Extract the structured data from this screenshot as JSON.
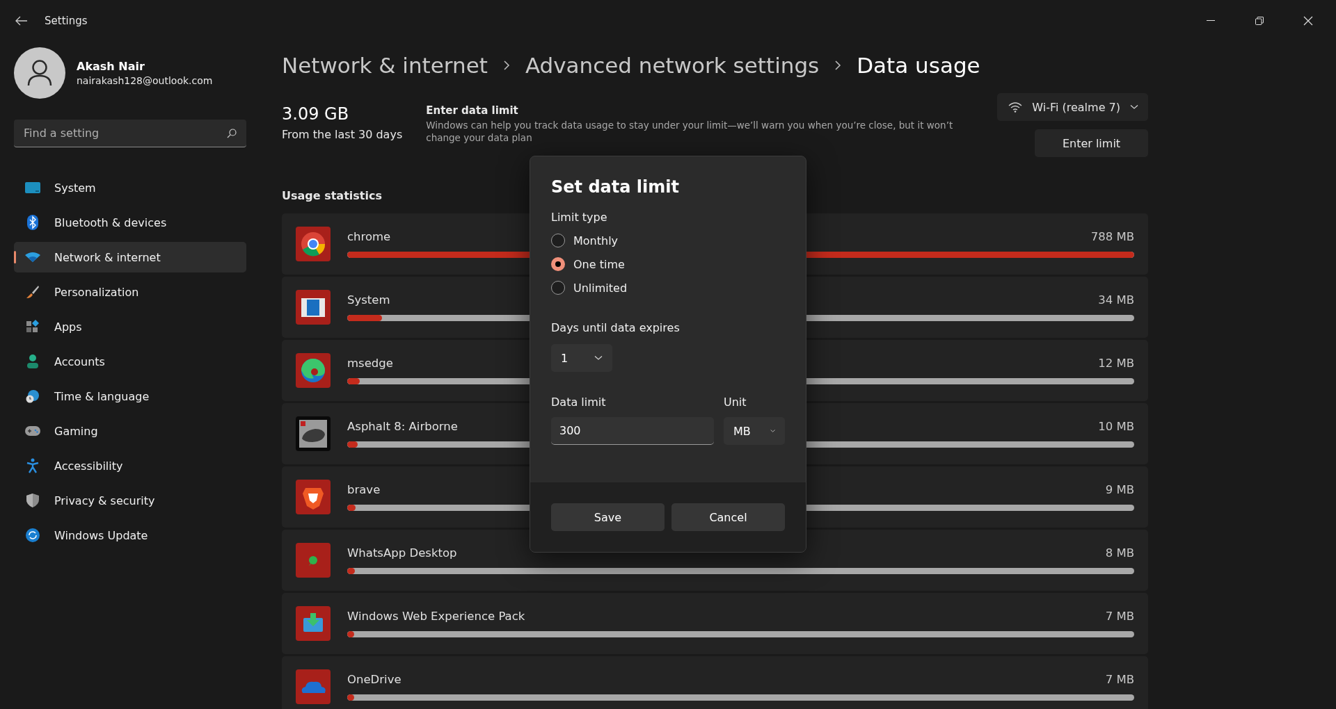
{
  "window": {
    "title": "Settings"
  },
  "account": {
    "name": "Akash Nair",
    "email": "nairakash128@outlook.com"
  },
  "search": {
    "placeholder": "Find a setting"
  },
  "sidebar": {
    "items": [
      {
        "label": "System",
        "selected": false
      },
      {
        "label": "Bluetooth & devices",
        "selected": false
      },
      {
        "label": "Network & internet",
        "selected": true
      },
      {
        "label": "Personalization",
        "selected": false
      },
      {
        "label": "Apps",
        "selected": false
      },
      {
        "label": "Accounts",
        "selected": false
      },
      {
        "label": "Time & language",
        "selected": false
      },
      {
        "label": "Gaming",
        "selected": false
      },
      {
        "label": "Accessibility",
        "selected": false
      },
      {
        "label": "Privacy & security",
        "selected": false
      },
      {
        "label": "Windows Update",
        "selected": false
      }
    ]
  },
  "breadcrumb": [
    "Network & internet",
    "Advanced network settings",
    "Data usage"
  ],
  "summary": {
    "total": "3.09 GB",
    "period": "From the last 30 days"
  },
  "limit_info": {
    "title": "Enter data limit",
    "description": "Windows can help you track data usage to stay under your limit—we’ll warn you when you’re close, but it won’t change your data plan"
  },
  "network_select": {
    "value": "Wi-Fi (realme 7)"
  },
  "enter_limit_button": "Enter limit",
  "usage_statistics": {
    "heading": "Usage statistics",
    "apps": [
      {
        "name": "chrome",
        "usage": "788 MB",
        "level": 1.0
      },
      {
        "name": "System",
        "usage": "34 MB",
        "level": 0.044
      },
      {
        "name": "msedge",
        "usage": "12 MB",
        "level": 0.016
      },
      {
        "name": "Asphalt 8: Airborne",
        "usage": "10 MB",
        "level": 0.013
      },
      {
        "name": "brave",
        "usage": "9 MB",
        "level": 0.011
      },
      {
        "name": "WhatsApp Desktop",
        "usage": "8 MB",
        "level": 0.01
      },
      {
        "name": "Windows Web Experience Pack",
        "usage": "7 MB",
        "level": 0.009
      },
      {
        "name": "OneDrive",
        "usage": "7 MB",
        "level": 0.009
      }
    ]
  },
  "dialog": {
    "title": "Set data limit",
    "limit_type_label": "Limit type",
    "options": [
      {
        "label": "Monthly",
        "selected": false
      },
      {
        "label": "One time",
        "selected": true
      },
      {
        "label": "Unlimited",
        "selected": false
      }
    ],
    "days_label": "Days until data expires",
    "days_value": "1",
    "data_limit_label": "Data limit",
    "data_limit_value": "300",
    "unit_label": "Unit",
    "unit_value": "MB",
    "buttons": [
      "Save",
      "Cancel"
    ]
  }
}
